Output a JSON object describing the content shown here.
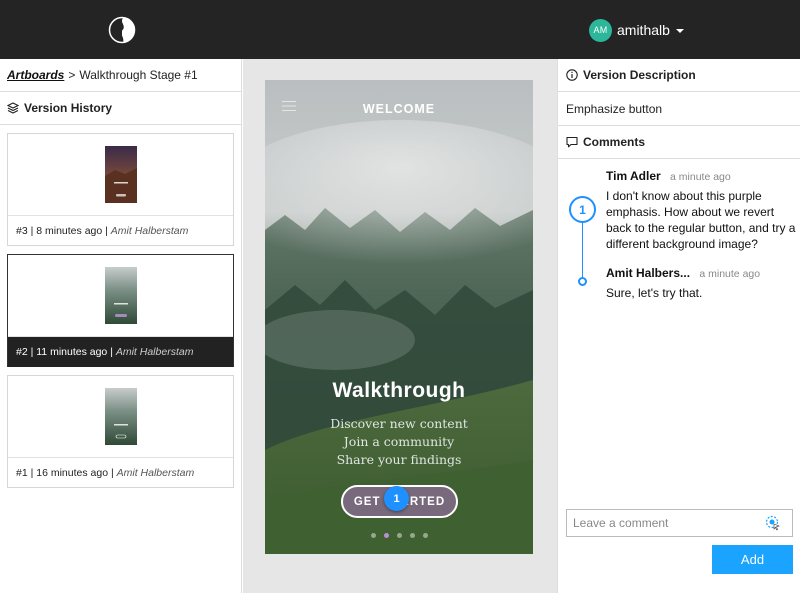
{
  "header": {
    "user_initials": "AM",
    "username": "amithalb"
  },
  "breadcrumb": {
    "root": "Artboards",
    "separator": ">",
    "current": "Walkthrough Stage #1"
  },
  "version_history": {
    "title": "Version History",
    "versions": [
      {
        "number": "#3",
        "time": "8 minutes ago",
        "author": "Amit Halberstam",
        "selected": false
      },
      {
        "number": "#2",
        "time": "11 minutes ago",
        "author": "Amit Halberstam",
        "selected": true
      },
      {
        "number": "#1",
        "time": "16 minutes ago",
        "author": "Amit Halberstam",
        "selected": false
      }
    ]
  },
  "artboard": {
    "header": "WELCOME",
    "title": "Walkthrough",
    "lines": [
      "Discover new content",
      "Join a community",
      "Share your findings"
    ],
    "cta": "GET STARTED",
    "pin": "1",
    "page_count": 5,
    "active_page": 2
  },
  "version_description": {
    "title": "Version Description",
    "text": "Emphasize button"
  },
  "comments": {
    "title": "Comments",
    "thread_number": "1",
    "items": [
      {
        "author": "Tim Adler",
        "time": "a minute ago",
        "text": "I don't know about this purple emphasis. How about we revert back to the regular button, and try a different background image?"
      },
      {
        "author": "Amit Halbers...",
        "time": "a minute ago",
        "text": "Sure, let's try that."
      }
    ],
    "input_placeholder": "Leave a comment",
    "add_label": "Add"
  },
  "colors": {
    "accent": "#1aa3ff",
    "topbar": "#242424",
    "avatar": "#2cb69a",
    "cta_fill": "#8c6e96"
  }
}
